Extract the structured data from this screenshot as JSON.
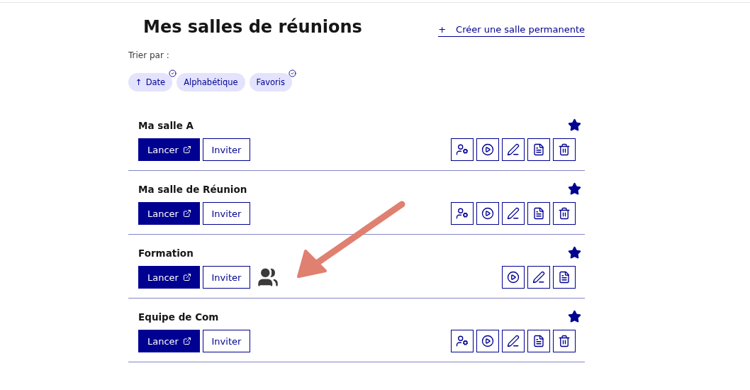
{
  "title": "Mes salles de réunions",
  "create_link": {
    "icon": "+",
    "label": "Créer une salle permanente"
  },
  "sort": {
    "label": "Trier par :",
    "options": [
      {
        "label": "Date",
        "arrow": "↑",
        "selected": true
      },
      {
        "label": "Alphabétique",
        "selected": false
      },
      {
        "label": "Favoris",
        "selected": true
      }
    ]
  },
  "rooms": [
    {
      "name": "Ma salle A",
      "favorite": true,
      "launch": "Lancer",
      "invite": "Inviter",
      "shared": false,
      "actions": [
        {
          "kind": "manage-users"
        },
        {
          "kind": "play"
        },
        {
          "kind": "edit"
        },
        {
          "kind": "document"
        },
        {
          "kind": "delete"
        }
      ]
    },
    {
      "name": "Ma salle de Réunion",
      "favorite": true,
      "launch": "Lancer",
      "invite": "Inviter",
      "shared": false,
      "actions": [
        {
          "kind": "manage-users"
        },
        {
          "kind": "play"
        },
        {
          "kind": "edit"
        },
        {
          "kind": "document"
        },
        {
          "kind": "delete"
        }
      ]
    },
    {
      "name": "Formation",
      "favorite": true,
      "launch": "Lancer",
      "invite": "Inviter",
      "shared": true,
      "actions": [
        {
          "kind": "play"
        },
        {
          "kind": "edit"
        },
        {
          "kind": "document"
        }
      ]
    },
    {
      "name": "Equipe de Com",
      "favorite": true,
      "launch": "Lancer",
      "invite": "Inviter",
      "shared": false,
      "actions": [
        {
          "kind": "manage-users"
        },
        {
          "kind": "play"
        },
        {
          "kind": "edit"
        },
        {
          "kind": "document"
        },
        {
          "kind": "delete"
        }
      ]
    }
  ],
  "annotation": {
    "kind": "arrow"
  }
}
